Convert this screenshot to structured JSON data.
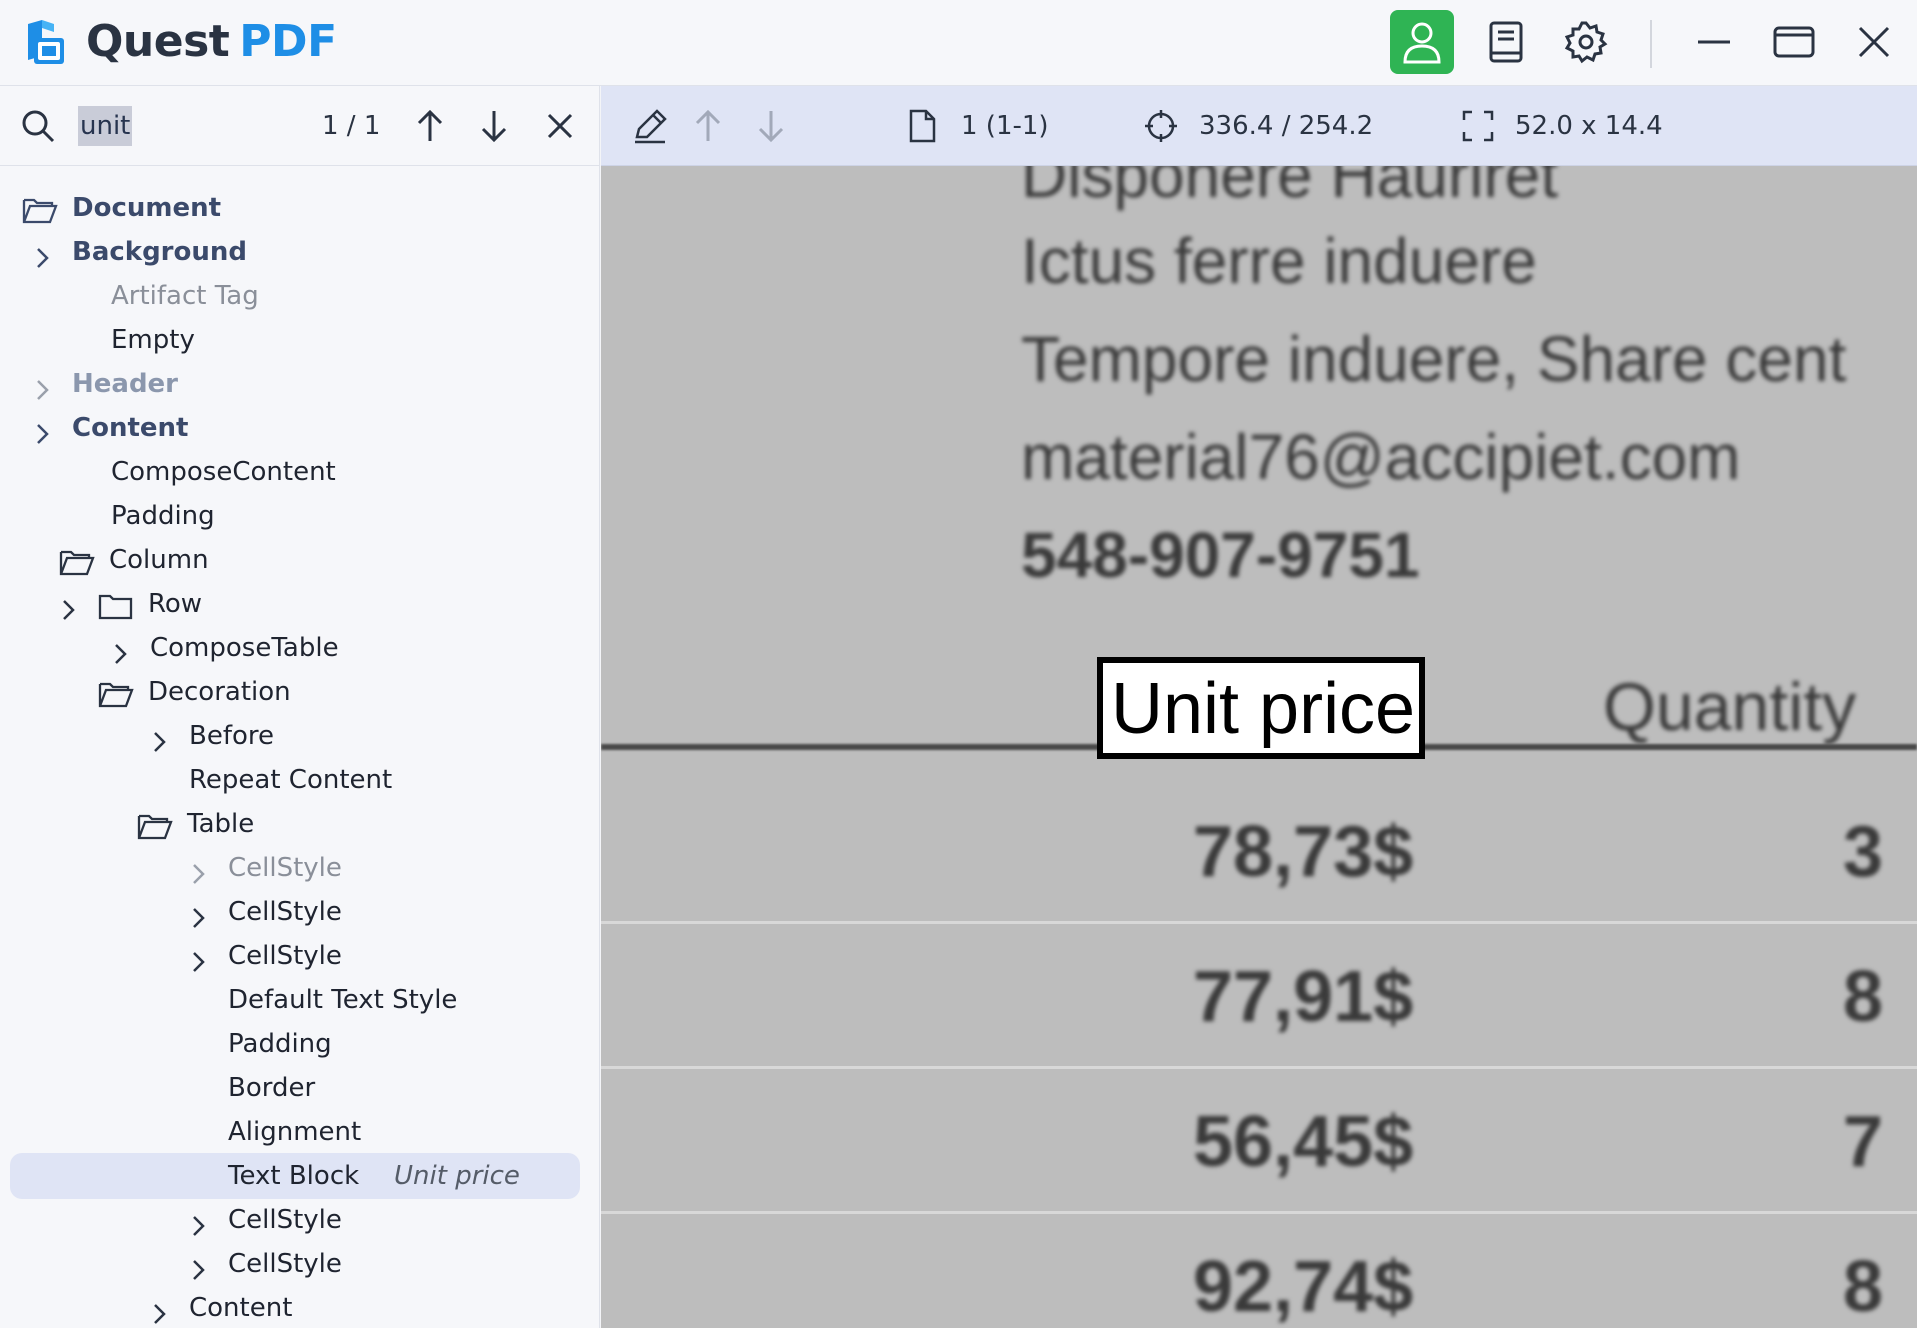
{
  "app": {
    "title_part1": "Quest",
    "title_part2": "PDF",
    "brand_color": "#1e8ee6",
    "account_button_color": "#2fb454",
    "title_icons": [
      "user-icon",
      "book-icon",
      "gear-icon",
      "minimize-icon",
      "maximize-icon",
      "close-icon"
    ]
  },
  "search": {
    "value": "unit",
    "match_count": "1 / 1"
  },
  "viewer_toolbar": {
    "page": "1 (1-1)",
    "position": "336.4 / 254.2",
    "size": "52.0 x 14.4"
  },
  "tree": [
    {
      "label": "Document",
      "icon": "folder-open-icon",
      "style": "blue"
    },
    {
      "label": "Background",
      "icon": "chevron-right-icon",
      "style": "blue"
    },
    {
      "label": "Artifact Tag",
      "style": "dim"
    },
    {
      "label": "Empty",
      "style": "normal"
    },
    {
      "label": "Header",
      "icon": "chevron-right-icon",
      "style": "dimblue"
    },
    {
      "label": "Content",
      "icon": "chevron-right-icon",
      "style": "blue"
    },
    {
      "label": "ComposeContent",
      "style": "normal"
    },
    {
      "label": "Padding",
      "style": "normal"
    },
    {
      "label": "Column",
      "icon": "folder-open-icon",
      "style": "normal"
    },
    {
      "label": "Row",
      "icon": "folder-icon",
      "style": "normal"
    },
    {
      "label": "ComposeTable",
      "icon": "chevron-right-icon",
      "style": "normal"
    },
    {
      "label": "Decoration",
      "icon": "folder-open-icon",
      "style": "normal"
    },
    {
      "label": "Before",
      "icon": "chevron-right-icon",
      "style": "normal"
    },
    {
      "label": "Repeat Content",
      "style": "normal"
    },
    {
      "label": "Table",
      "icon": "folder-open-icon",
      "style": "normal"
    },
    {
      "label": "CellStyle",
      "icon": "chevron-right-icon",
      "style": "dim"
    },
    {
      "label": "CellStyle",
      "icon": "chevron-right-icon",
      "style": "normal"
    },
    {
      "label": "CellStyle",
      "icon": "chevron-right-icon",
      "style": "normal"
    },
    {
      "label": "Default Text Style",
      "style": "normal"
    },
    {
      "label": "Padding",
      "style": "normal"
    },
    {
      "label": "Border",
      "style": "normal"
    },
    {
      "label": "Alignment",
      "style": "normal"
    },
    {
      "label": "Text Block",
      "hint": "Unit price",
      "style": "normal",
      "selected": true
    },
    {
      "label": "CellStyle",
      "icon": "chevron-right-icon",
      "style": "normal"
    },
    {
      "label": "CellStyle",
      "icon": "chevron-right-icon",
      "style": "normal"
    },
    {
      "label": "Content",
      "icon": "chevron-right-icon",
      "style": "normal"
    }
  ],
  "document": {
    "lines": [
      "Disponere Hauriret",
      "Ictus ferre induere",
      "Tempore induere, Share cent",
      "material76@accipiet.com",
      "548-907-9751"
    ],
    "highlighted_text": "Unit price",
    "column_header_2": "Quantity",
    "prices": [
      "78,73$",
      "77,91$",
      "56,45$",
      "92,74$"
    ],
    "quantities": [
      "3",
      "8",
      "7",
      "8"
    ]
  }
}
